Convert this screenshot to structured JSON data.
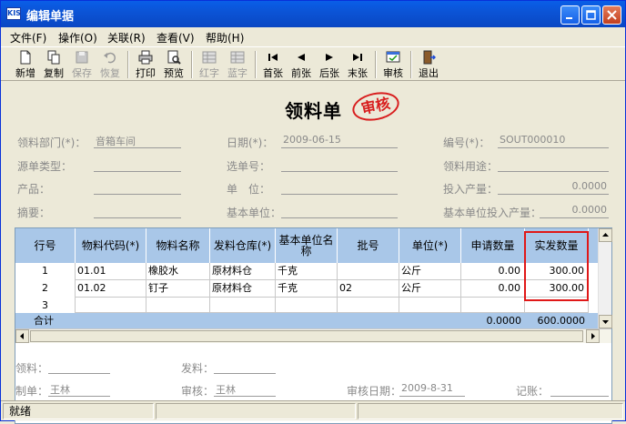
{
  "window": {
    "title": "编辑单据",
    "app_icon": "KIS"
  },
  "menu": [
    "文件(F)",
    "操作(O)",
    "关联(R)",
    "查看(V)",
    "帮助(H)"
  ],
  "toolbar": {
    "new": "新增",
    "copy": "复制",
    "save": "保存",
    "restore": "恢复",
    "print": "打印",
    "preview": "预览",
    "red": "红字",
    "blue": "蓝字",
    "first": "首张",
    "prev": "前张",
    "next": "后张",
    "last": "末张",
    "audit": "审核",
    "exit": "退出"
  },
  "doc": {
    "title": "领料单",
    "stamp": "审核",
    "fields": {
      "dept_label": "领料部门(*)：",
      "dept_value": "音箱车间",
      "date_label": "日期(*)：",
      "date_value": "2009-06-15",
      "no_label": "编号(*)：",
      "no_value": "SOUT000010",
      "src_label": "源单类型：",
      "src_value": "",
      "sel_label": "选单号：",
      "sel_value": "",
      "use_label": "领料用途：",
      "use_value": "",
      "product_label": "产品：",
      "product_value": "",
      "unit_label": "单　位：",
      "unit_value": "",
      "input_label": "投入产量：",
      "input_value": "0.0000",
      "summary_label": "摘要：",
      "summary_value": "",
      "baseunit_label": "基本单位：",
      "baseunit_value": "",
      "baseinput_label": "基本单位投入产量：",
      "baseinput_value": "0.0000"
    },
    "grid": {
      "headers": [
        "行号",
        "物料代码(*)",
        "物料名称",
        "发料仓库(*)",
        "基本单位名称",
        "批号",
        "单位(*)",
        "申请数量",
        "实发数量"
      ],
      "rows": [
        {
          "no": "1",
          "code": "01.01",
          "name": "橡胶水",
          "wh": "原材料仓",
          "bunit": "千克",
          "batch": "",
          "unit": "公斤",
          "req": "0.00",
          "qty": "300.00"
        },
        {
          "no": "2",
          "code": "01.02",
          "name": "钉子",
          "wh": "原材料仓",
          "bunit": "千克",
          "batch": "02",
          "unit": "公斤",
          "req": "0.00",
          "qty": "300.00"
        },
        {
          "no": "3",
          "code": "",
          "name": "",
          "wh": "",
          "bunit": "",
          "batch": "",
          "unit": "",
          "req": "",
          "qty": ""
        }
      ],
      "total": {
        "label": "合计",
        "req": "0.0000",
        "qty": "600.0000"
      }
    },
    "footer": {
      "picker_label": "领料：",
      "picker_value": "",
      "issuer_label": "发料：",
      "issuer_value": "",
      "maker_label": "制单：",
      "maker_value": "王林",
      "auditor_label": "审核：",
      "auditor_value": "王林",
      "audit_date_label": "审核日期：",
      "audit_date_value": "2009-8-31",
      "book_label": "记账：",
      "book_value": ""
    }
  },
  "status": {
    "text": "就绪"
  }
}
